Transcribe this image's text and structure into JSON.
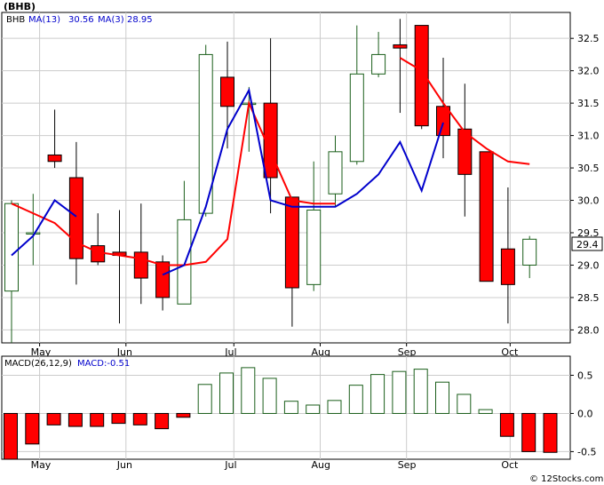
{
  "header": {
    "title": "(BHB)",
    "ticker": "BHB",
    "ma13_label": "MA(13)",
    "ma13_value": "30.56",
    "ma3_label": "MA(3)",
    "ma3_value": "28.95",
    "macd_label": "MACD(26,12,9)",
    "macd_value_label": "MACD:-0.51",
    "last_price_tag": "29.4",
    "watermark": "© 12Stocks.com"
  },
  "colors": {
    "up": "#1a5e1a",
    "down": "#ff0000",
    "ma13": "#ff0000",
    "ma3": "#0000cc",
    "grid": "#cccccc",
    "frame": "#000000"
  },
  "chart_data": [
    {
      "type": "candlestick",
      "title": "(BHB)",
      "ylim": [
        27.8,
        32.9
      ],
      "yticks": [
        "28.0",
        "28.5",
        "29.0",
        "29.5",
        "30.0",
        "30.5",
        "31.0",
        "31.5",
        "32.0",
        "32.5"
      ],
      "ytick_values": [
        28.0,
        28.5,
        29.0,
        29.5,
        30.0,
        30.5,
        31.0,
        31.5,
        32.0,
        32.5
      ],
      "x_month_labels": [
        "May",
        "Jun",
        "Jul",
        "Aug",
        "Sep",
        "Oct"
      ],
      "x_month_weeks": [
        1.3,
        5.3,
        10.3,
        14.3,
        18.3,
        23.1
      ],
      "candles": [
        {
          "o": 28.6,
          "h": 30.0,
          "l": 27.8,
          "c": 29.95
        },
        {
          "o": 29.5,
          "h": 30.1,
          "l": 29.0,
          "c": 29.5
        },
        {
          "o": 30.7,
          "h": 31.4,
          "l": 30.5,
          "c": 30.6
        },
        {
          "o": 30.35,
          "h": 30.9,
          "l": 28.7,
          "c": 29.1
        },
        {
          "o": 29.3,
          "h": 29.8,
          "l": 29.0,
          "c": 29.05
        },
        {
          "o": 29.2,
          "h": 29.85,
          "l": 28.1,
          "c": 29.15
        },
        {
          "o": 29.2,
          "h": 29.95,
          "l": 28.4,
          "c": 28.8
        },
        {
          "o": 29.05,
          "h": 29.15,
          "l": 28.3,
          "c": 28.5
        },
        {
          "o": 28.4,
          "h": 30.3,
          "l": 28.4,
          "c": 29.7
        },
        {
          "o": 29.8,
          "h": 32.4,
          "l": 29.75,
          "c": 32.25
        },
        {
          "o": 31.9,
          "h": 32.45,
          "l": 30.8,
          "c": 31.45
        },
        {
          "o": 31.5,
          "h": 31.75,
          "l": 30.75,
          "c": 31.5
        },
        {
          "o": 31.5,
          "h": 32.5,
          "l": 29.8,
          "c": 30.35
        },
        {
          "o": 30.05,
          "h": 30.05,
          "l": 28.05,
          "c": 28.65
        },
        {
          "o": 28.7,
          "h": 30.6,
          "l": 28.6,
          "c": 29.85
        },
        {
          "o": 30.1,
          "h": 31.0,
          "l": 29.9,
          "c": 30.75
        },
        {
          "o": 30.6,
          "h": 32.7,
          "l": 30.55,
          "c": 31.95
        },
        {
          "o": 31.95,
          "h": 32.6,
          "l": 31.9,
          "c": 32.25
        },
        {
          "o": 32.4,
          "h": 32.8,
          "l": 31.35,
          "c": 32.35
        },
        {
          "o": 32.7,
          "h": 32.7,
          "l": 31.1,
          "c": 31.15
        },
        {
          "o": 31.45,
          "h": 32.2,
          "l": 30.65,
          "c": 31.0
        },
        {
          "o": 31.1,
          "h": 31.8,
          "l": 29.75,
          "c": 30.4
        },
        {
          "o": 30.75,
          "h": 30.75,
          "l": 28.75,
          "c": 28.75
        },
        {
          "o": 29.25,
          "h": 30.2,
          "l": 28.1,
          "c": 28.7
        },
        {
          "o": 29.0,
          "h": 29.45,
          "l": 28.8,
          "c": 29.4
        }
      ],
      "series": [
        {
          "name": "MA(13)",
          "values": [
            29.95,
            29.8,
            29.65,
            29.35,
            29.2,
            29.15,
            29.1,
            29.0,
            29.0,
            29.05,
            29.4,
            31.5,
            30.75,
            30.0,
            29.95,
            29.95,
            null,
            null,
            32.2,
            32.0,
            31.5,
            31.05,
            30.8,
            30.6,
            30.56
          ]
        },
        {
          "name": "MA(3)",
          "values": [
            29.15,
            29.45,
            30.0,
            29.75,
            null,
            null,
            null,
            28.85,
            29.0,
            29.9,
            31.1,
            31.7,
            30.0,
            29.9,
            29.9,
            29.9,
            30.1,
            30.4,
            30.9,
            30.15,
            31.2,
            null,
            null,
            null,
            null
          ]
        }
      ]
    },
    {
      "type": "bar",
      "title": "MACD(26,12,9)",
      "ylim": [
        -0.6,
        0.75
      ],
      "yticks": [
        "0.5",
        "0.0",
        "-0.5"
      ],
      "ytick_values": [
        0.5,
        0.0,
        -0.5
      ],
      "x_month_labels": [
        "May",
        "Jun",
        "Jul",
        "Aug",
        "Sep",
        "Oct"
      ],
      "values": [
        -0.6,
        -0.4,
        -0.15,
        -0.17,
        -0.17,
        -0.13,
        -0.15,
        -0.2,
        -0.05,
        0.38,
        0.53,
        0.6,
        0.46,
        0.16,
        0.11,
        0.17,
        0.37,
        0.51,
        0.55,
        0.58,
        0.41,
        0.25,
        0.05,
        -0.3,
        -0.5,
        -0.51
      ]
    }
  ]
}
